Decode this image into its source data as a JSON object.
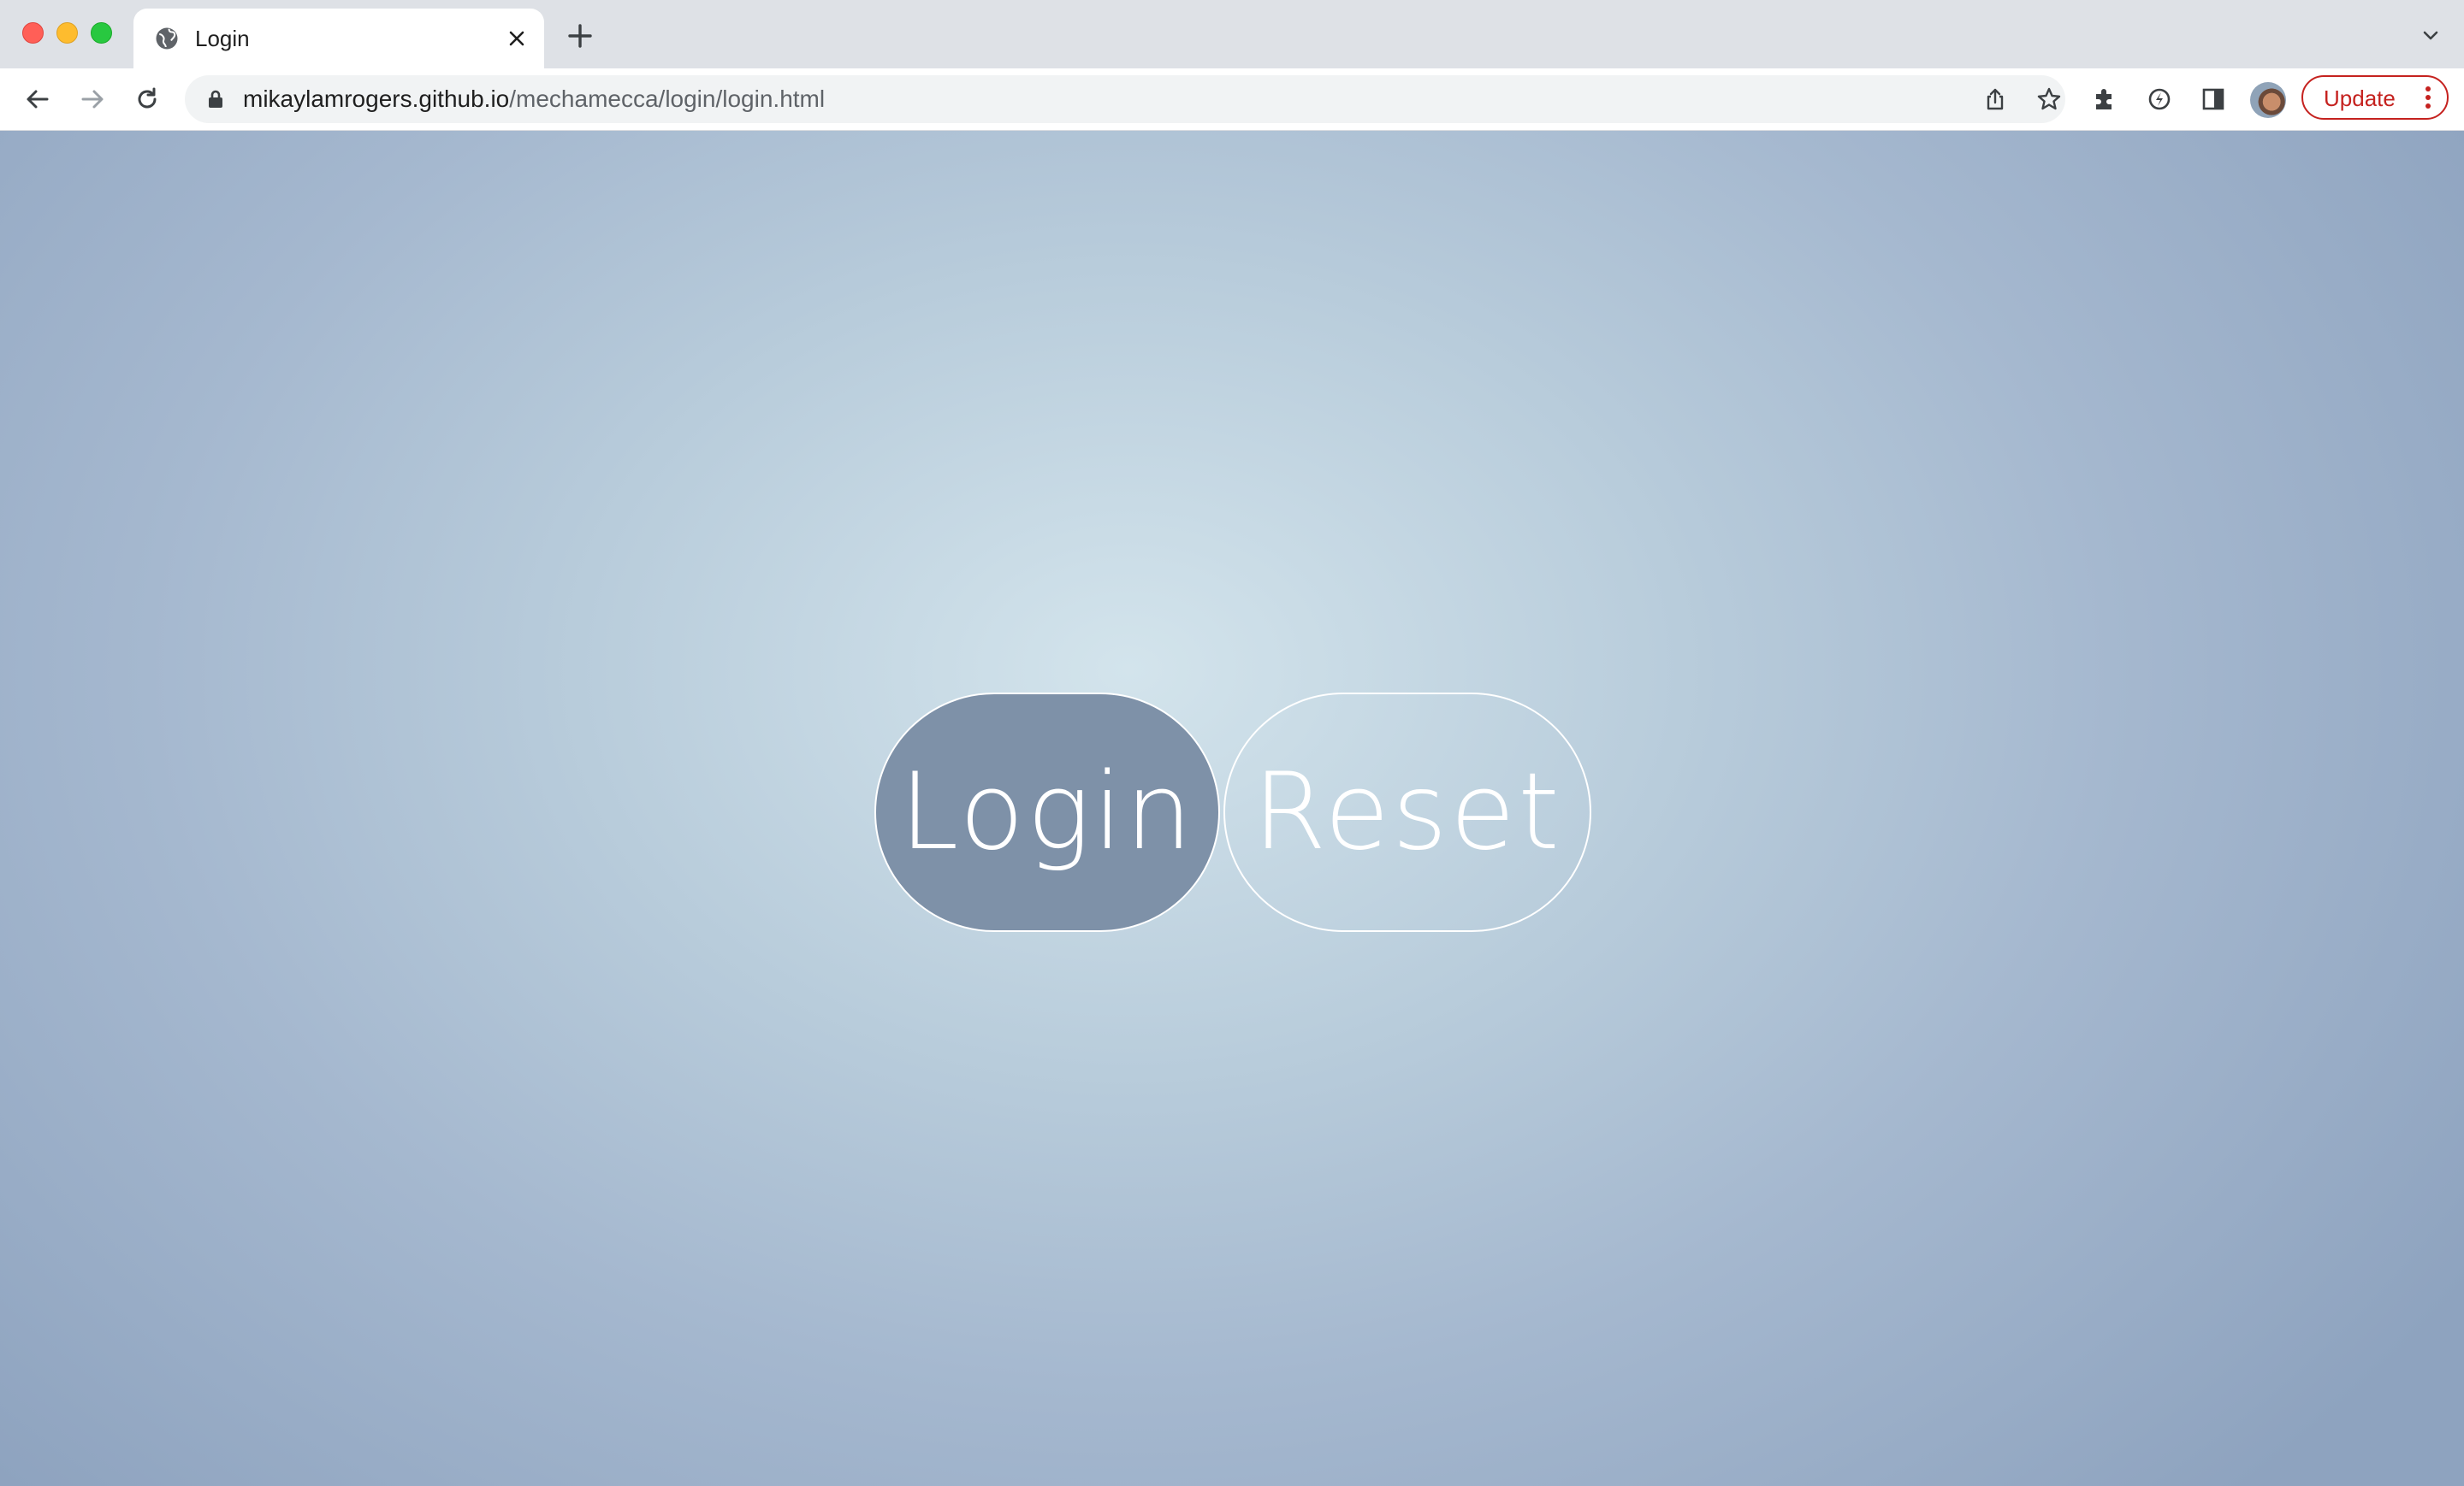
{
  "browser": {
    "tab": {
      "title": "Login",
      "favicon": "globe-icon",
      "close_icon": "close-icon"
    },
    "new_tab_icon": "plus-icon",
    "tab_search_icon": "chevron-down-icon",
    "toolbar": {
      "back_icon": "arrow-left-icon",
      "forward_icon": "arrow-right-icon",
      "reload_icon": "reload-icon"
    },
    "address_bar": {
      "host": "mikaylamrogers.github.io",
      "path": "/mechamecca/login/login.html",
      "lock_icon": "lock-icon",
      "share_icon": "share-icon",
      "bookmark_icon": "star-icon"
    },
    "extensions_icon": "puzzle-icon",
    "performance_icon": "leaf-bolt-icon",
    "side_panel_icon": "side-panel-icon",
    "update_button": {
      "label": "Update",
      "color": "#c5221f"
    }
  },
  "page": {
    "login_button": {
      "label": "Login"
    },
    "reset_button": {
      "label": "Reset"
    },
    "colors": {
      "login_fill": "#7e91a8",
      "background_center": "#d3e4ec",
      "background_edge": "#8ea3bf",
      "outline": "#ffffff"
    }
  }
}
